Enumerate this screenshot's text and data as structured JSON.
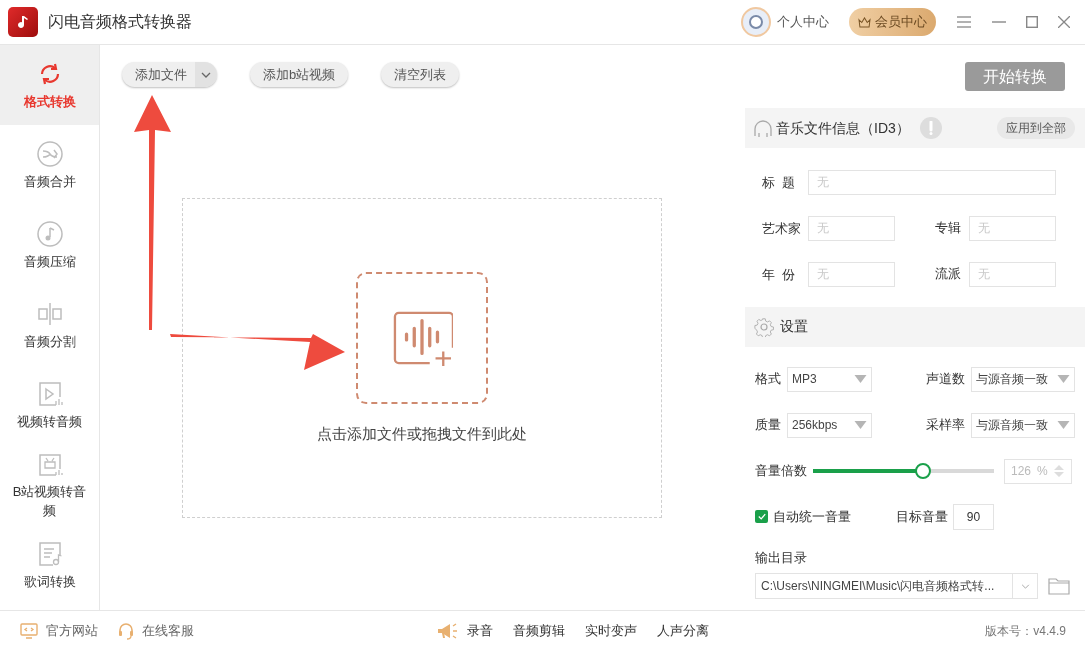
{
  "window": {
    "title": "闪电音频格式转换器",
    "user_center": "个人中心",
    "vip_center": "会员中心"
  },
  "sidebar": {
    "items": [
      {
        "label": "格式转换",
        "selected": true
      },
      {
        "label": "音频合并",
        "selected": false
      },
      {
        "label": "音频压缩",
        "selected": false
      },
      {
        "label": "音频分割",
        "selected": false
      },
      {
        "label": "视频转音频",
        "selected": false
      },
      {
        "label": "B站视频转音频",
        "selected": false
      },
      {
        "label": "歌词转换",
        "selected": false
      }
    ]
  },
  "toolbar": {
    "add_file": "添加文件",
    "add_bilibili": "添加b站视频",
    "clear_list": "清空列表",
    "start": "开始转换"
  },
  "drop_zone": {
    "hint": "点击添加文件或拖拽文件到此处"
  },
  "id3": {
    "title": "音乐文件信息（ID3）",
    "apply_all": "应用到全部",
    "fields": [
      {
        "label": "标  题",
        "placeholder": "无",
        "wide": true
      },
      {
        "label": "艺术家",
        "placeholder": "无",
        "wide": false
      },
      {
        "label": "专辑",
        "placeholder": "无",
        "wide": false
      },
      {
        "label": "年  份",
        "placeholder": "无",
        "wide": false
      },
      {
        "label": "流派",
        "placeholder": "无",
        "wide": false
      }
    ]
  },
  "settings": {
    "title": "设置",
    "selects": [
      {
        "label": "格式",
        "value": "MP3"
      },
      {
        "label": "声道数",
        "value": "与源音频一致"
      },
      {
        "label": "质量",
        "value": "256kbps"
      },
      {
        "label": "采样率",
        "value": "与源音频一致"
      }
    ],
    "volume": {
      "label": "音量倍数",
      "level": 0.61,
      "value": "126",
      "unit": "%"
    },
    "auto_normalize": {
      "label": "自动统一音量",
      "checked": true
    },
    "target_volume": {
      "label": "目标音量",
      "value": "90"
    },
    "output": {
      "label": "输出目录",
      "value": "C:\\Users\\NINGMEI\\Music\\闪电音频格式转..."
    }
  },
  "footer": {
    "links": [
      "官方网站",
      "在线客服"
    ],
    "tools": [
      "录音",
      "音频剪辑",
      "实时变声",
      "人声分离"
    ],
    "version": "版本号：v4.4.9"
  }
}
